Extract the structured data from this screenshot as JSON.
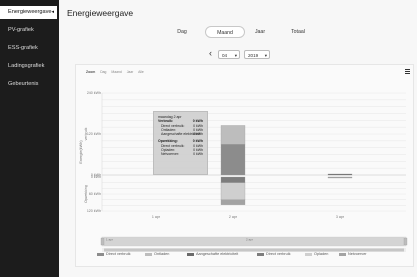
{
  "sidebar": {
    "items": [
      {
        "label": "Energieweergave",
        "active": true
      },
      {
        "label": "PV-grafiek"
      },
      {
        "label": "ESS-grafiek"
      },
      {
        "label": "Ladingsgrafiek"
      },
      {
        "label": "Gebeurtenis"
      }
    ],
    "active_arrow": "◂"
  },
  "page": {
    "title": "Energieweergave"
  },
  "tabs": [
    {
      "label": "Dag"
    },
    {
      "label": "Maand",
      "active": true
    },
    {
      "label": "Jaar"
    },
    {
      "label": "Totaal"
    }
  ],
  "period": {
    "prev_icon": "chevron-left-icon",
    "prev_glyph": "‹",
    "month": "04",
    "year": "2019",
    "chevron": "▾"
  },
  "chart_toolbar": {
    "items": [
      "Zoom",
      "Dag",
      "Maand",
      "Jaar",
      "Alle"
    ],
    "active": "Zoom"
  },
  "chart_data": {
    "type": "bar",
    "stacked": true,
    "categories": [
      "1 apr",
      "2 apr",
      "3 apr"
    ],
    "y_axis_upper": {
      "label": "verbruik",
      "ticks": [
        "0 kWh",
        "120 kWh",
        "240 kWh"
      ]
    },
    "y_axis_lower": {
      "label": "Opwekking",
      "ticks": [
        "0 kWh",
        "60 kWh",
        "120 kWh"
      ]
    },
    "y_axis_title": "Energie(kWh)",
    "legend": [
      "Direct verbruik",
      "Ontladen",
      "Aangeschafte elektriciteit",
      "Direct verbruik",
      "Opladen",
      "Netvoerver"
    ],
    "colors": [
      "#8c8c8c",
      "#bdbdbd",
      "#6a6a6a",
      "#7d7d7d",
      "#cfcfcf",
      "#a3a3a3"
    ],
    "series_upper": [
      {
        "name": "Direct verbruik",
        "values": [
          0,
          90,
          0
        ]
      },
      {
        "name": "Ontladen",
        "values": [
          0,
          55,
          0
        ]
      },
      {
        "name": "Aangeschafte elektriciteit",
        "values": [
          0,
          0,
          2
        ]
      }
    ],
    "series_lower": [
      {
        "name": "Direct verbruik",
        "values": [
          0,
          20,
          0
        ]
      },
      {
        "name": "Opladen",
        "values": [
          0,
          60,
          0
        ]
      },
      {
        "name": "Netvoerver",
        "values": [
          0,
          18,
          2
        ]
      }
    ],
    "navigator_labels": [
      "1 apr",
      "2 apr"
    ],
    "tooltip": {
      "date": "maandag 2 apr",
      "rows": [
        {
          "label": "Verbruik:",
          "value": "0 kWh",
          "bold": true
        },
        {
          "label": "Direct verbruik:",
          "value": "0 kWh"
        },
        {
          "label": "Ontladen:",
          "value": "0 kWh"
        },
        {
          "label": "Aangeschafte elektriciteit:",
          "value": "0 kWh"
        },
        {
          "label": "Opwekking:",
          "value": "0 kWh",
          "bold": true
        },
        {
          "label": "Direct verbruik:",
          "value": "0 kWh"
        },
        {
          "label": "Opladen:",
          "value": "0 kWh"
        },
        {
          "label": "Netvoerver:",
          "value": "0 kWh"
        }
      ]
    }
  }
}
